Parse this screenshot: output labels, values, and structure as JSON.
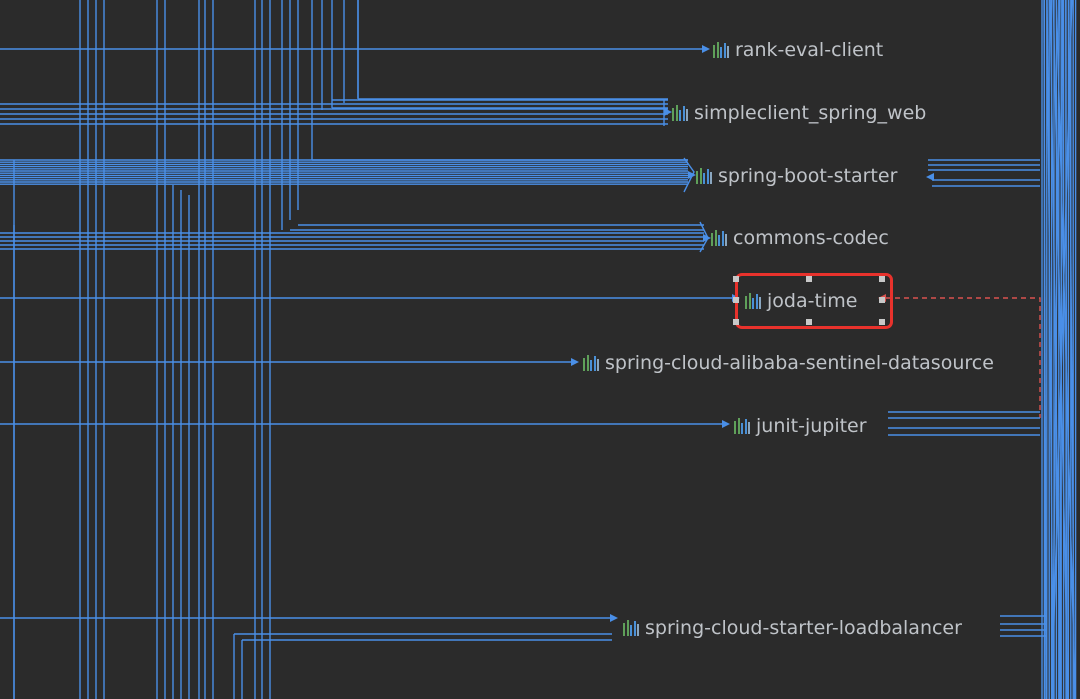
{
  "colors": {
    "background": "#2b2b2b",
    "edge": "#4a8fe7",
    "selected_edge": "#d9534f",
    "selection_border": "#e8322c",
    "node_text": "#bfc3c8"
  },
  "graph": {
    "nodes": [
      {
        "id": "rank-eval-client",
        "label": "rank-eval-client",
        "icon": "library-icon"
      },
      {
        "id": "simpleclient-spring-web",
        "label": "simpleclient_spring_web",
        "icon": "library-icon"
      },
      {
        "id": "spring-boot-starter",
        "label": "spring-boot-starter",
        "icon": "library-icon"
      },
      {
        "id": "commons-codec",
        "label": "commons-codec",
        "icon": "library-icon"
      },
      {
        "id": "joda-time",
        "label": "joda-time",
        "icon": "library-icon",
        "selected": true
      },
      {
        "id": "spring-cloud-alibaba-sentinel-datasource",
        "label": "spring-cloud-alibaba-sentinel-datasource",
        "icon": "library-icon"
      },
      {
        "id": "junit-jupiter",
        "label": "junit-jupiter",
        "icon": "library-icon"
      },
      {
        "id": "spring-cloud-starter-loadbalancer",
        "label": "spring-cloud-starter-loadbalancer",
        "icon": "library-icon"
      }
    ]
  }
}
